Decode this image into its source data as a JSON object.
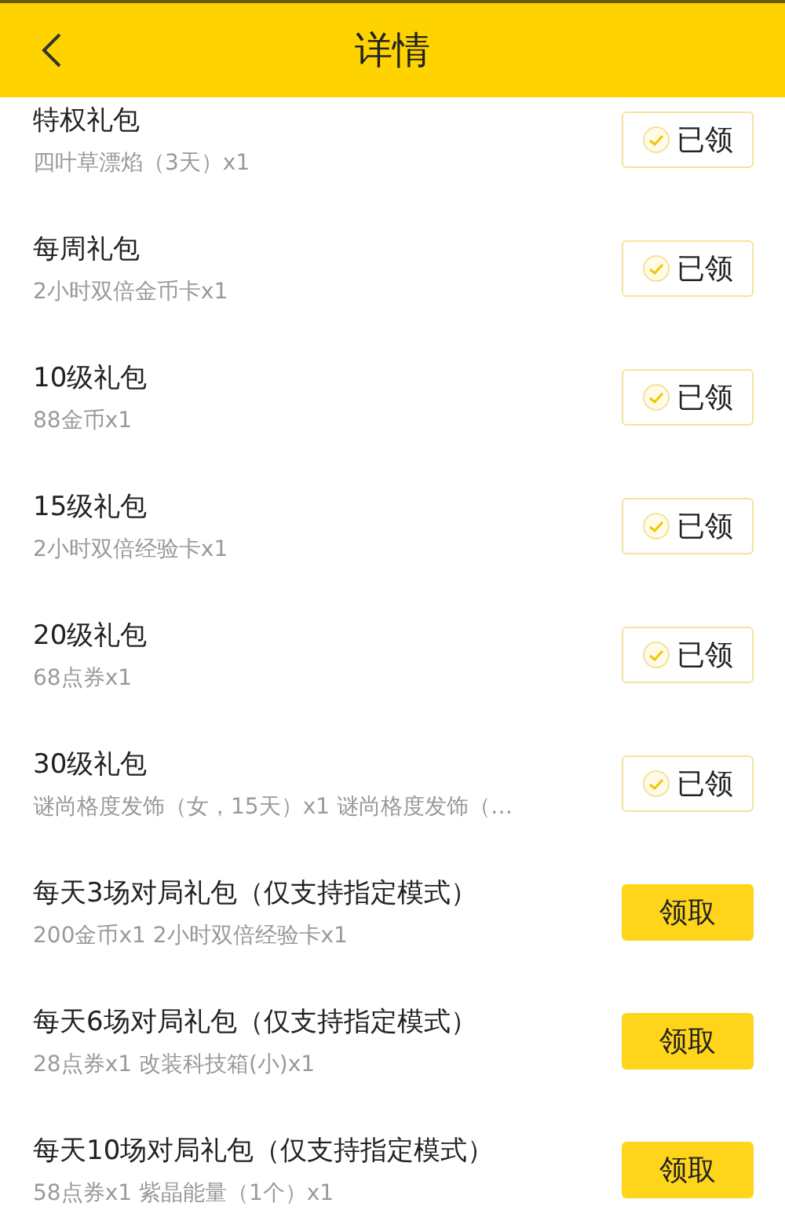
{
  "header": {
    "title": "详情"
  },
  "gifts": [
    {
      "title": "特权礼包",
      "rewards": "四叶草漂焰（3天）x1",
      "claimed": true,
      "button": "已领"
    },
    {
      "title": "每周礼包",
      "rewards": "2小时双倍金币卡x1",
      "claimed": true,
      "button": "已领"
    },
    {
      "title": "10级礼包",
      "rewards": "88金币x1",
      "claimed": true,
      "button": "已领"
    },
    {
      "title": "15级礼包",
      "rewards": "2小时双倍经验卡x1",
      "claimed": true,
      "button": "已领"
    },
    {
      "title": "20级礼包",
      "rewards": "68点券x1",
      "claimed": true,
      "button": "已领"
    },
    {
      "title": "30级礼包",
      "rewards": "谜尚格度发饰（女，15天）x1 谜尚格度发饰（…",
      "claimed": true,
      "button": "已领"
    },
    {
      "title": "每天3场对局礼包（仅支持指定模式）",
      "rewards": "200金币x1 2小时双倍经验卡x1",
      "claimed": false,
      "button": "领取"
    },
    {
      "title": "每天6场对局礼包（仅支持指定模式）",
      "rewards": "28点券x1 改装科技箱(小)x1",
      "claimed": false,
      "button": "领取"
    },
    {
      "title": "每天10场对局礼包（仅支持指定模式）",
      "rewards": "58点券x1 紫晶能量（1个）x1",
      "claimed": false,
      "button": "领取"
    }
  ]
}
